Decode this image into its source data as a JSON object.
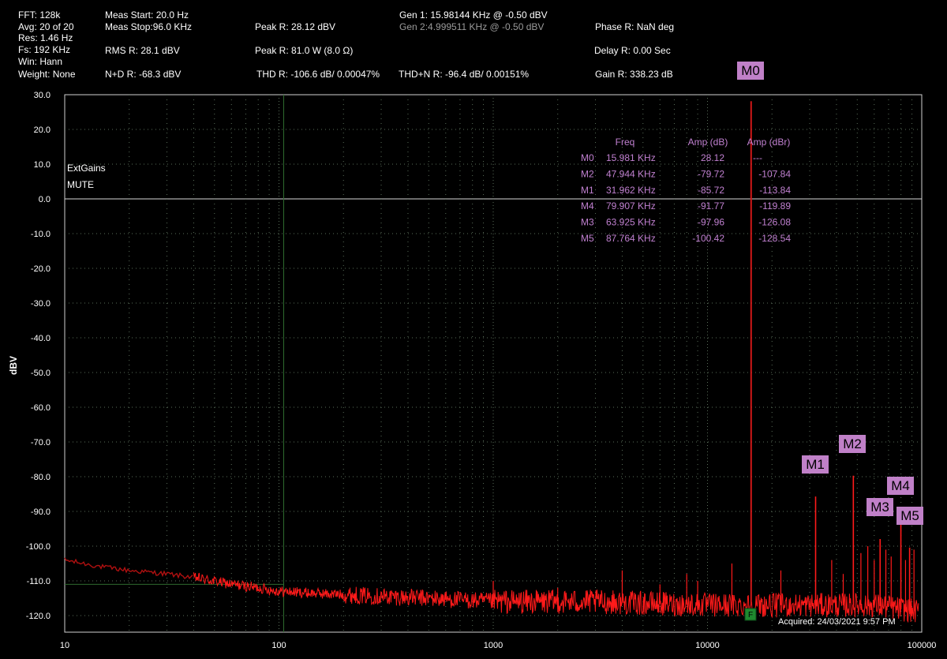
{
  "header": {
    "fft": "FFT: 128k",
    "avg": "Avg: 20 of 20",
    "res": "Res: 1.46 Hz",
    "fs": "Fs: 192 KHz",
    "win": "Win: Hann",
    "weight": "Weight: None",
    "meas_start": "Meas Start: 20.0 Hz",
    "meas_stop": "Meas Stop:96.0 KHz",
    "rms": "RMS R: 28.1 dBV",
    "nd": "N+D R: -68.3 dBV",
    "peak1": "Peak R: 28.12 dBV",
    "peak2": "Peak R: 81.0 W (8.0 Ω)",
    "thd": "THD R: -106.6 dB/ 0.00047%",
    "gen1": "Gen 1: 15.98144 KHz @ -0.50  dBV",
    "gen2": "Gen 2:4.999511 KHz @ -0.50  dBV",
    "thdn": "THD+N R: -96.4 dB/ 0.00151%",
    "phase": "Phase R: NaN deg",
    "delay": "Delay R: 0.00 Sec",
    "gain": "Gain R: 338.23 dB"
  },
  "chart_data": {
    "type": "line",
    "xscale": "log",
    "xlim": [
      10,
      100000
    ],
    "ylim": [
      -125,
      30
    ],
    "ylabel": "dBV",
    "yticks": [
      "30.0",
      "20.0",
      "10.0",
      "0.0",
      "-10.0",
      "-20.0",
      "-30.0",
      "-40.0",
      "-50.0",
      "-60.0",
      "-70.0",
      "-80.0",
      "-90.0",
      "-100.0",
      "-110.0",
      "-120.0"
    ],
    "xticks": [
      "10",
      "100",
      "1000",
      "10000",
      "100000"
    ],
    "grid": true,
    "annotations": [
      "ExtGains",
      "MUTE"
    ],
    "acquired": "Acquired: 24/03/2021  9:57 PM",
    "flag_label": "F",
    "noise_floor": [
      [
        10,
        -104
      ],
      [
        15,
        -106
      ],
      [
        20,
        -107
      ],
      [
        30,
        -108
      ],
      [
        40,
        -109
      ],
      [
        60,
        -111
      ],
      [
        80,
        -112
      ],
      [
        100,
        -113
      ],
      [
        200,
        -114
      ],
      [
        500,
        -115
      ],
      [
        1000,
        -116
      ],
      [
        3000,
        -116
      ],
      [
        10000,
        -117
      ],
      [
        30000,
        -117
      ],
      [
        60000,
        -117
      ],
      [
        100000,
        -119
      ]
    ],
    "spurs": [
      [
        1000,
        -110
      ],
      [
        1600,
        -113
      ],
      [
        2000,
        -112
      ],
      [
        4000,
        -107
      ],
      [
        6000,
        -111
      ],
      [
        8000,
        -108
      ],
      [
        9000,
        -110
      ],
      [
        13000,
        -105
      ],
      [
        22000,
        -107
      ],
      [
        38000,
        -104
      ],
      [
        43000,
        -108
      ],
      [
        52000,
        -102
      ],
      [
        56000,
        -100
      ],
      [
        60000,
        -104
      ],
      [
        68000,
        -101
      ],
      [
        72000,
        -103
      ],
      [
        84000,
        -104
      ],
      [
        92000,
        -101
      ]
    ],
    "peaks": [
      {
        "name": "M0",
        "freq": 15981,
        "amp": 28.12
      },
      {
        "name": "M1",
        "freq": 31962,
        "amp": -85.72
      },
      {
        "name": "M2",
        "freq": 47944,
        "amp": -79.72
      },
      {
        "name": "M3",
        "freq": 63925,
        "amp": -97.96
      },
      {
        "name": "M4",
        "freq": 79907,
        "amp": -91.77
      },
      {
        "name": "M5",
        "freq": 87764,
        "amp": -100.42
      }
    ],
    "marker_table": {
      "headers": [
        "Freq",
        "Amp (dB)",
        "Amp (dBr)"
      ],
      "rows": [
        {
          "m": "M0",
          "freq": "15.981 KHz",
          "amp": "28.12",
          "ampr": "---"
        },
        {
          "m": "M2",
          "freq": "47.944 KHz",
          "amp": "-79.72",
          "ampr": "-107.84"
        },
        {
          "m": "M1",
          "freq": "31.962 KHz",
          "amp": "-85.72",
          "ampr": "-113.84"
        },
        {
          "m": "M4",
          "freq": "79.907 KHz",
          "amp": "-91.77",
          "ampr": "-119.89"
        },
        {
          "m": "M3",
          "freq": "63.925 KHz",
          "amp": "-97.96",
          "ampr": "-126.08"
        },
        {
          "m": "M5",
          "freq": "87.764 KHz",
          "amp": "-100.42",
          "ampr": "-128.54"
        }
      ]
    },
    "colors": {
      "trace": "#ff1a1a",
      "trace_dark": "#b01010",
      "marker_bg": "#c080c8",
      "table_text": "#c080d0",
      "grid": "#5a6e5a"
    }
  }
}
